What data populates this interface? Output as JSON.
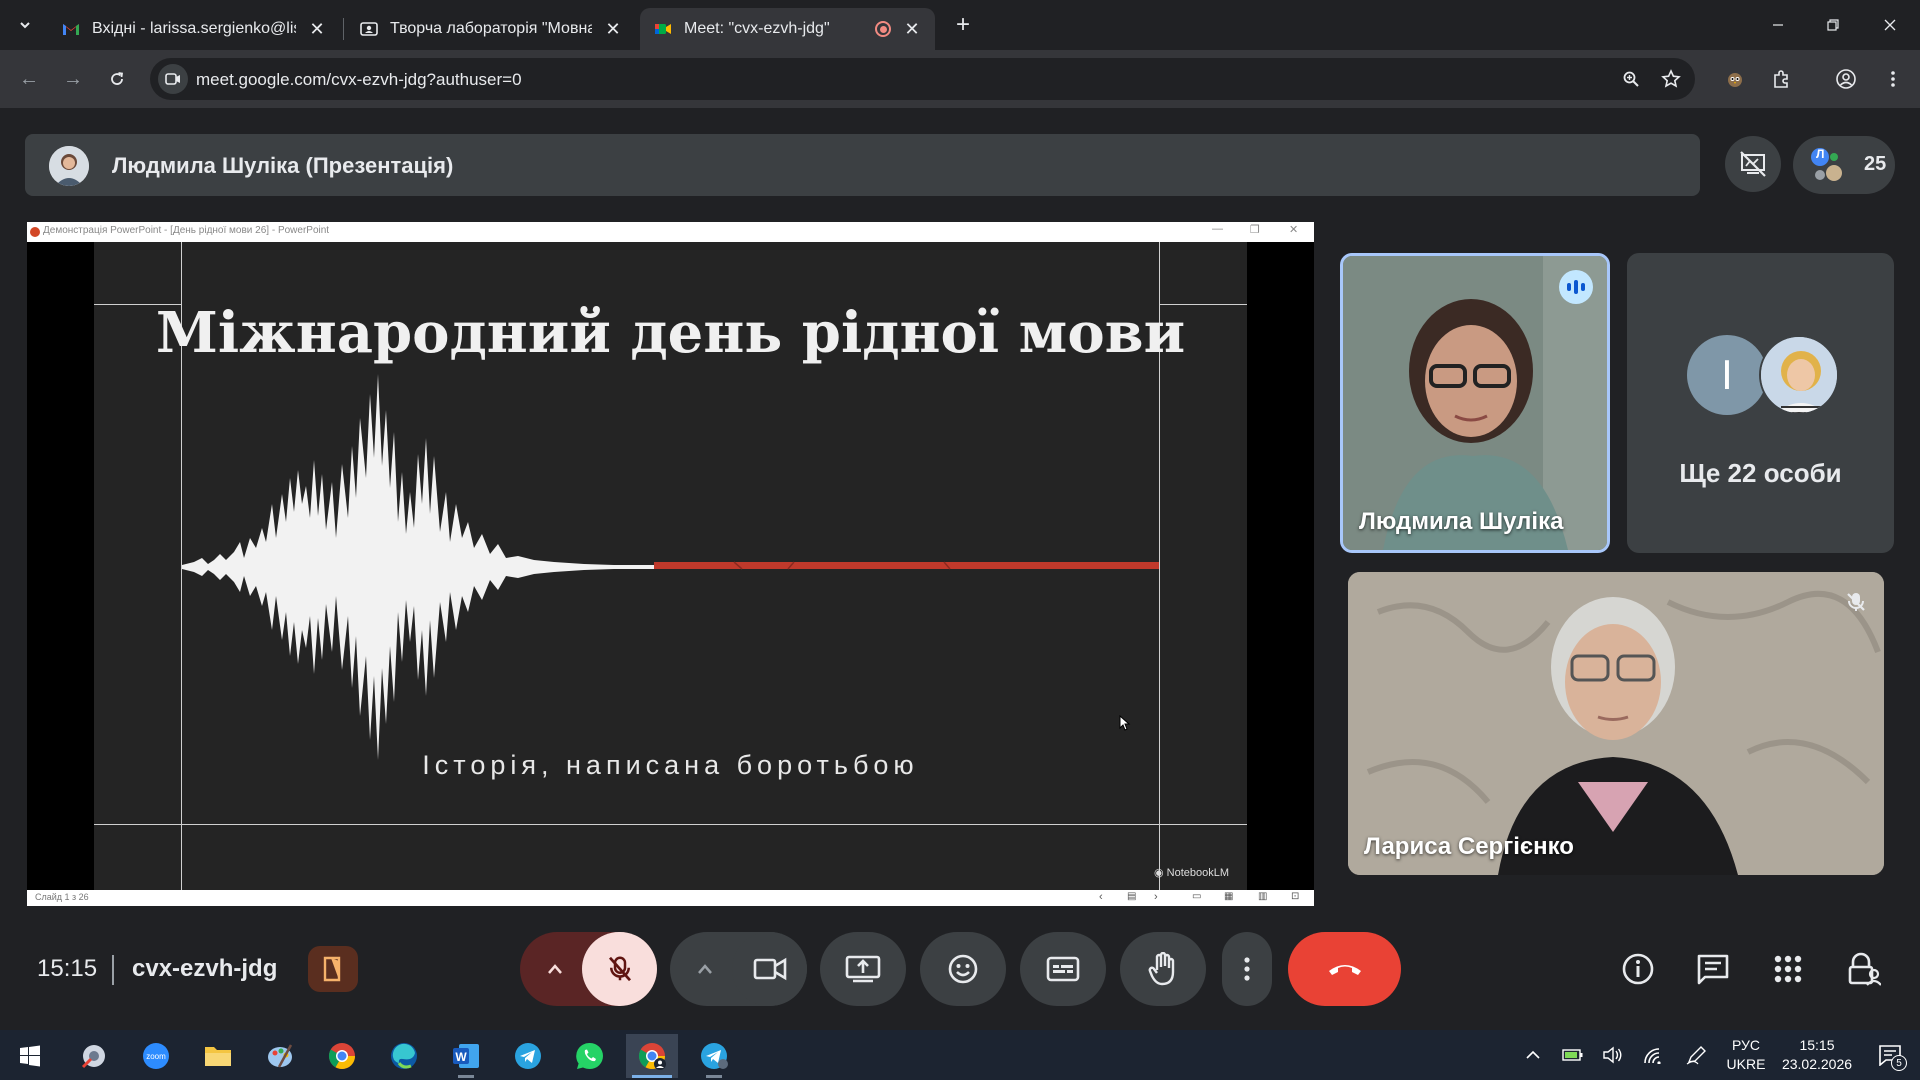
{
  "browser": {
    "tabs": [
      {
        "title": "Вхідні - larissa.sergienko@lispk",
        "icon": "gmail-icon"
      },
      {
        "title": "Творча лабораторія \"Мовна п",
        "icon": "classroom-icon"
      },
      {
        "title": "Meet: \"cvx-ezvh-jdg\"",
        "icon": "meet-icon",
        "active": true
      }
    ],
    "url": "meet.google.com/cvx-ezvh-jdg?authuser=0"
  },
  "meet": {
    "presenter_label": "Людмила Шуліка (Презентація)",
    "participant_count": "25",
    "people_initial": "Л",
    "presentation": {
      "window_title": "Демонстрація PowerPoint - [День рідної мови 26] - PowerPoint",
      "slide_title": "Міжнародний день рідної мови",
      "slide_subtitle": "Історія, написана боротьбою",
      "watermark": "NotebookLM",
      "status": "Слайд 1 з 26"
    },
    "tiles": [
      {
        "name": "Людмила Шуліка",
        "speaking": true
      },
      {
        "name": "Ще 22 особи",
        "avatar_initial": "I"
      },
      {
        "name": "Лариса Сергієнко",
        "muted": true
      }
    ],
    "time": "15:15",
    "meeting_code": "cvx-ezvh-jdg",
    "colors": {
      "end_call": "#e94235",
      "mic_muted_bg": "#f9dedc",
      "speaking": "#c2e7ff",
      "slide_accent": "#c0392b"
    }
  },
  "taskbar": {
    "apps": [
      "start-icon",
      "tools-icon",
      "zoom-icon",
      "file-explorer-icon",
      "paint-icon",
      "chrome-icon",
      "edge-icon",
      "word-icon",
      "telegram-icon",
      "whatsapp-icon",
      "chrome-profile-icon",
      "telegram-desktop-icon"
    ],
    "lang_top": "РУС",
    "lang_bottom": "UKRE",
    "time": "15:15",
    "date": "23.02.2026",
    "notifications": "5"
  }
}
